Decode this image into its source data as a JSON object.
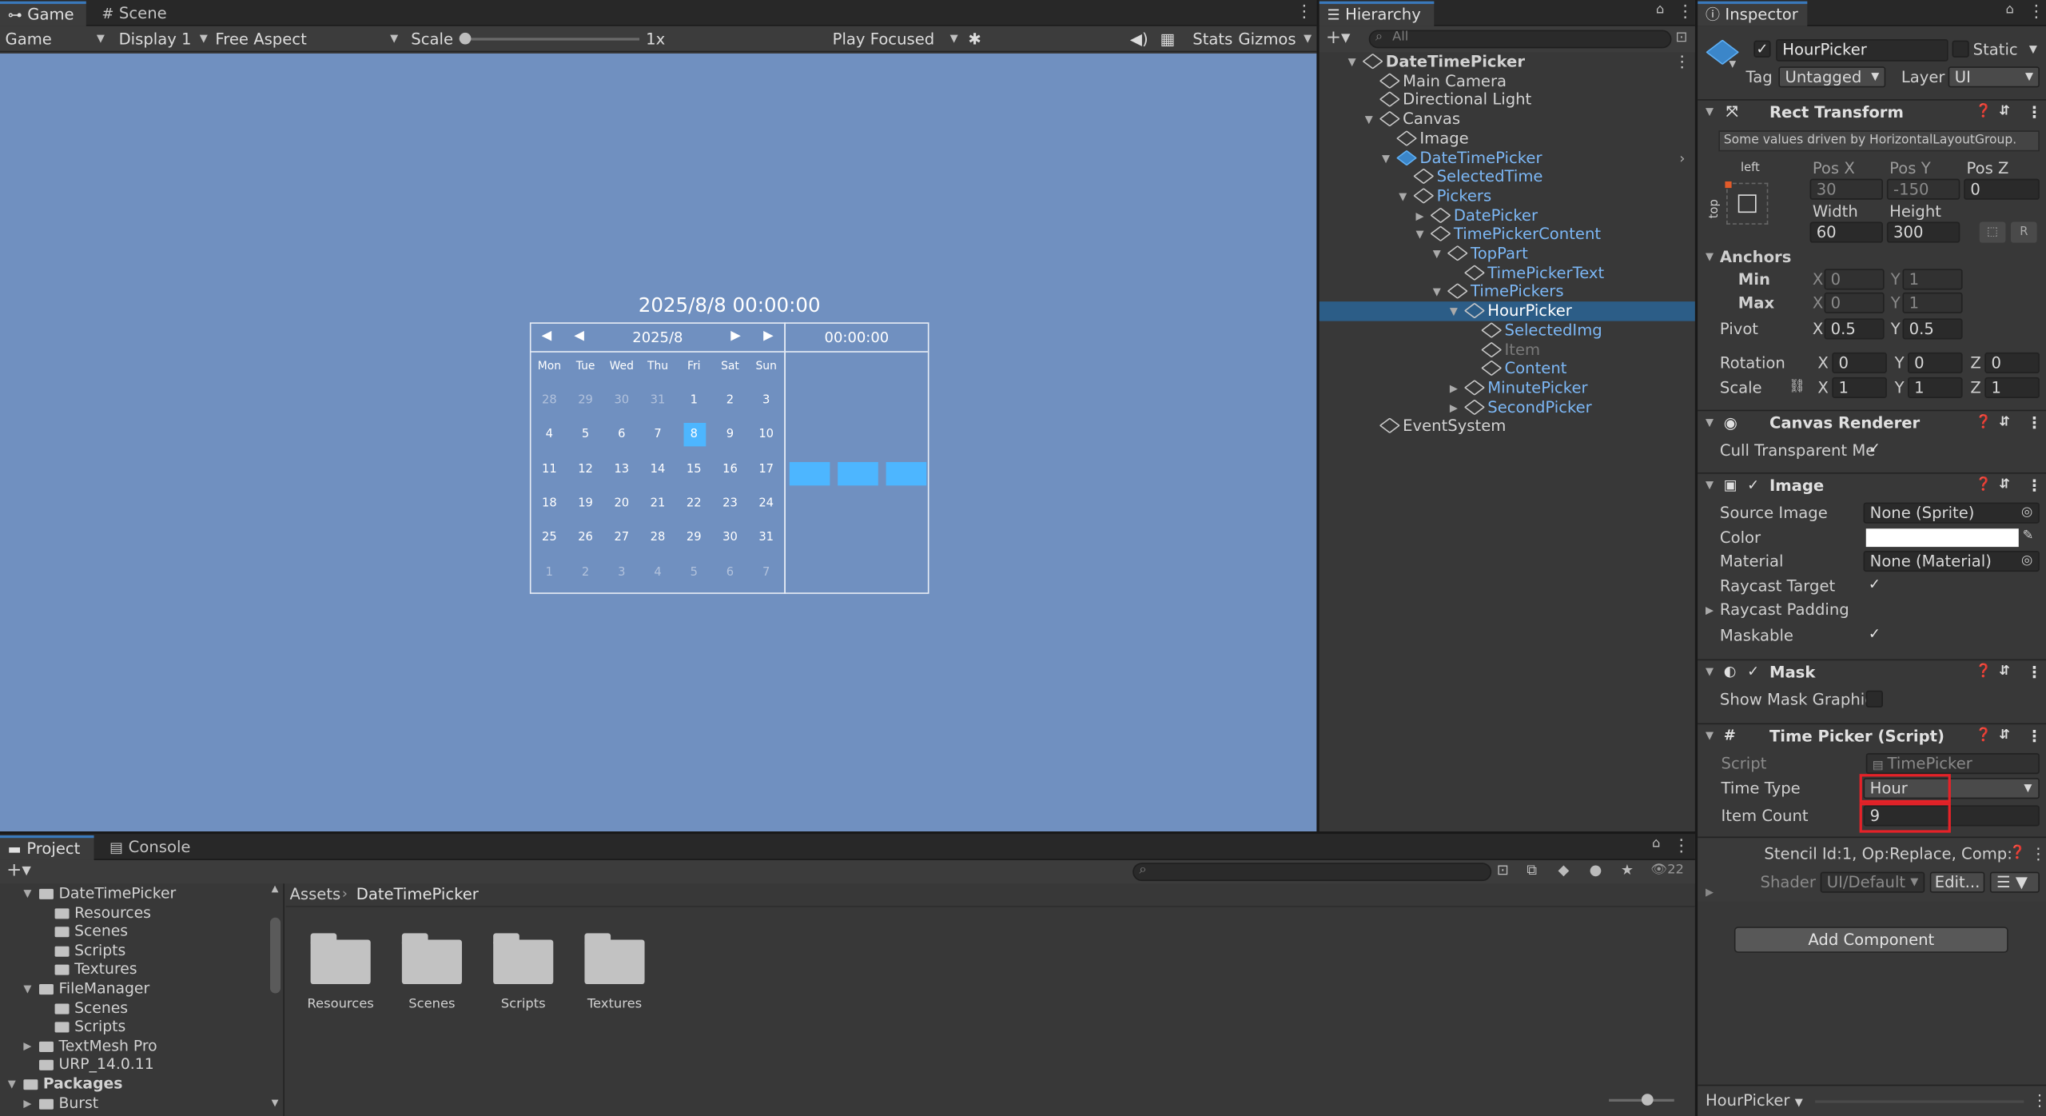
{
  "game": {
    "tabs": [
      {
        "label": "Game",
        "icon": "gamepad-icon"
      },
      {
        "label": "Scene",
        "icon": "grid-icon"
      }
    ],
    "toolbar": {
      "view": "Game",
      "display": "Display 1",
      "aspect": "Free Aspect",
      "scale_label": "Scale",
      "scale_value": "1x",
      "scale_level": 0,
      "play_mode": "Play Focused",
      "stats": "Stats",
      "gizmos": "Gizmos"
    },
    "background": "#7090c0",
    "picker": {
      "title": "2025/8/8 00:00:00",
      "month": "2025/8",
      "time": "00:00:00",
      "nav_prev_year": "◀",
      "nav_prev_month": "◀",
      "nav_next_month": "▶",
      "nav_next_year": "▶",
      "weekdays": [
        "Mon",
        "Tue",
        "Wed",
        "Thu",
        "Fri",
        "Sat",
        "Sun"
      ],
      "weeks": [
        [
          "28",
          "29",
          "30",
          "31",
          "1",
          "2",
          "3"
        ],
        [
          "4",
          "5",
          "6",
          "7",
          "8",
          "9",
          "10"
        ],
        [
          "11",
          "12",
          "13",
          "14",
          "15",
          "16",
          "17"
        ],
        [
          "18",
          "19",
          "20",
          "21",
          "22",
          "23",
          "24"
        ],
        [
          "25",
          "26",
          "27",
          "28",
          "29",
          "30",
          "31"
        ],
        [
          "1",
          "2",
          "3",
          "4",
          "5",
          "6",
          "7"
        ]
      ],
      "selected_day": "8",
      "accent": "#4db6ff"
    }
  },
  "hierarchy": {
    "tab": "Hierarchy",
    "search_placeholder": "All",
    "items": [
      {
        "label": "DateTimePicker",
        "depth": 0,
        "expanded": true,
        "bold": true
      },
      {
        "label": "Main Camera",
        "depth": 1
      },
      {
        "label": "Directional Light",
        "depth": 1
      },
      {
        "label": "Canvas",
        "depth": 1,
        "expanded": true
      },
      {
        "label": "Image",
        "depth": 2
      },
      {
        "label": "DateTimePicker",
        "depth": 2,
        "expanded": true,
        "prefab": true
      },
      {
        "label": "SelectedTime",
        "depth": 3,
        "prefab_child": true
      },
      {
        "label": "Pickers",
        "depth": 3,
        "expanded": true,
        "prefab_child": true
      },
      {
        "label": "DatePicker",
        "depth": 4,
        "collapsed": true,
        "prefab_child": true
      },
      {
        "label": "TimePickerContent",
        "depth": 4,
        "expanded": true,
        "prefab_child": true
      },
      {
        "label": "TopPart",
        "depth": 5,
        "expanded": true,
        "prefab_child": true
      },
      {
        "label": "TimePickerText",
        "depth": 6,
        "prefab_child": true
      },
      {
        "label": "TimePickers",
        "depth": 5,
        "expanded": true,
        "prefab_child": true
      },
      {
        "label": "HourPicker",
        "depth": 6,
        "expanded": true,
        "selected": true
      },
      {
        "label": "SelectedImg",
        "depth": 7,
        "prefab_child": true
      },
      {
        "label": "Item",
        "depth": 7,
        "inactive": true
      },
      {
        "label": "Content",
        "depth": 7,
        "prefab_child": true
      },
      {
        "label": "MinutePicker",
        "depth": 6,
        "collapsed": true,
        "prefab_child": true
      },
      {
        "label": "SecondPicker",
        "depth": 6,
        "collapsed": true,
        "prefab_child": true
      },
      {
        "label": "EventSystem",
        "depth": 1
      }
    ]
  },
  "inspector": {
    "tab": "Inspector",
    "object_name": "HourPicker",
    "static_label": "Static",
    "tag_label": "Tag",
    "tag_value": "Untagged",
    "layer_label": "Layer",
    "layer_value": "UI",
    "rect": {
      "title": "Rect Transform",
      "note": "Some values driven by HorizontalLayoutGroup.",
      "anchor_h": "left",
      "anchor_v": "top",
      "posx_label": "Pos X",
      "posx": "30",
      "posy_label": "Pos Y",
      "posy": "-150",
      "posz_label": "Pos Z",
      "posz": "0",
      "width_label": "Width",
      "width": "60",
      "height_label": "Height",
      "height": "300",
      "r_btn": "R",
      "anchors_label": "Anchors",
      "min_label": "Min",
      "min_x": "0",
      "min_y": "1",
      "max_label": "Max",
      "max_x": "0",
      "max_y": "1",
      "pivot_label": "Pivot",
      "pivot_x": "0.5",
      "pivot_y": "0.5",
      "rotation_label": "Rotation",
      "rot_x": "0",
      "rot_y": "0",
      "rot_z": "0",
      "scale_label": "Scale",
      "scale_x": "1",
      "scale_y": "1",
      "scale_z": "1",
      "x": "X",
      "y": "Y",
      "z": "Z"
    },
    "canvas_renderer": {
      "title": "Canvas Renderer",
      "cull_label": "Cull Transparent Me"
    },
    "image": {
      "title": "Image",
      "source_label": "Source Image",
      "source_value": "None (Sprite)",
      "color_label": "Color",
      "material_label": "Material",
      "material_value": "None (Material)",
      "raycast_label": "Raycast Target",
      "padding_label": "Raycast Padding",
      "maskable_label": "Maskable"
    },
    "mask": {
      "title": "Mask",
      "show_label": "Show Mask Graphic"
    },
    "time_picker": {
      "title": "Time Picker (Script)",
      "script_label": "Script",
      "script_value": "TimePicker",
      "type_label": "Time Type",
      "type_value": "Hour",
      "count_label": "Item Count",
      "count_value": "9"
    },
    "material_info": "Stencil Id:1, Op:Replace, Comp:",
    "shader_label": "Shader",
    "shader_value": "UI/Default",
    "edit_button": "Edit...",
    "add_component": "Add Component",
    "footer": "HourPicker"
  },
  "project": {
    "tabs": [
      {
        "label": "Project",
        "icon": "folder-icon"
      },
      {
        "label": "Console",
        "icon": "console-icon"
      }
    ],
    "hidden_count": "22",
    "tree": [
      {
        "label": "DateTimePicker",
        "depth": 0,
        "expanded": true,
        "open": true
      },
      {
        "label": "Resources",
        "depth": 1
      },
      {
        "label": "Scenes",
        "depth": 1
      },
      {
        "label": "Scripts",
        "depth": 1
      },
      {
        "label": "Textures",
        "depth": 1
      },
      {
        "label": "FileManager",
        "depth": 0,
        "expanded": true,
        "open": true
      },
      {
        "label": "Scenes",
        "depth": 1
      },
      {
        "label": "Scripts",
        "depth": 1
      },
      {
        "label": "TextMesh Pro",
        "depth": 0,
        "collapsed": true
      },
      {
        "label": "URP_14.0.11",
        "depth": 0
      },
      {
        "label": "Packages",
        "depth": -1,
        "expanded": true,
        "open": true
      },
      {
        "label": "Burst",
        "depth": 0,
        "collapsed": true
      }
    ],
    "breadcrumb": [
      "Assets",
      "DateTimePicker"
    ],
    "folders": [
      "Resources",
      "Scenes",
      "Scripts",
      "Textures"
    ]
  }
}
